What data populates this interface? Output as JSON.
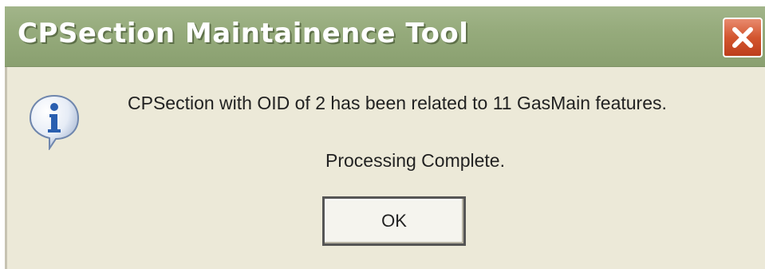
{
  "window": {
    "title": "CPSection Maintainence Tool",
    "close_icon": "close-icon"
  },
  "dialog": {
    "icon": "info-icon",
    "message": "CPSection with OID of 2 has been related to 11 GasMain features.",
    "status": "Processing Complete.",
    "ok_label": "OK"
  },
  "colors": {
    "titlebar": "#96ab7c",
    "dialog_bg": "#ece9d8",
    "close_button": "#d3562f",
    "info_blue": "#2a5fb0"
  }
}
